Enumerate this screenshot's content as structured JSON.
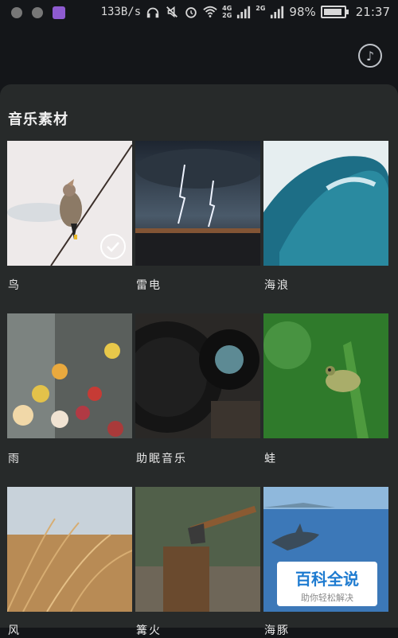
{
  "status_bar": {
    "net_speed": "133B/s",
    "battery": "98%",
    "time": "21:37",
    "signal_top": "4G",
    "signal_bottom": "2G",
    "signal_label": "2G"
  },
  "sheet": {
    "title": "音乐素材"
  },
  "items": [
    {
      "label": "鸟",
      "selected": true
    },
    {
      "label": "雷电"
    },
    {
      "label": "海浪"
    },
    {
      "label": "雨"
    },
    {
      "label": "助眠音乐"
    },
    {
      "label": "蛙"
    },
    {
      "label": "风"
    },
    {
      "label": "篝火"
    },
    {
      "label": "海豚"
    }
  ],
  "watermark": {
    "title": "百科全说",
    "subtitle": "助你轻松解决"
  }
}
